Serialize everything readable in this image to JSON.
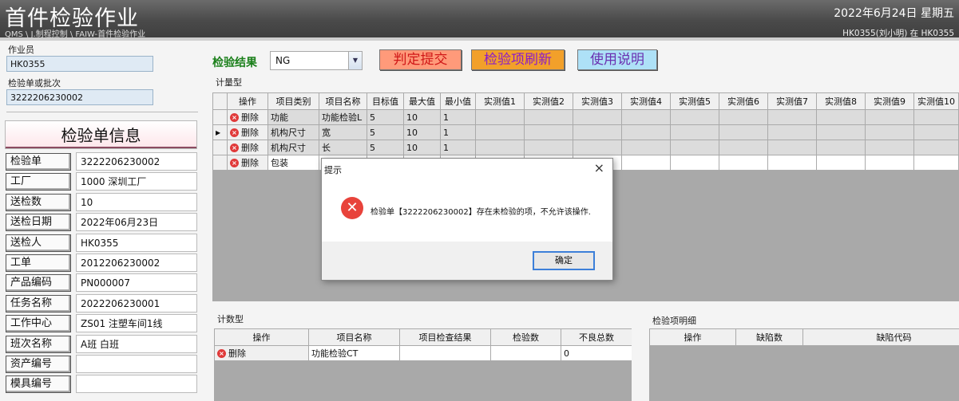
{
  "header": {
    "title": "首件检验作业",
    "breadcrumb": "QMS \\ J.制程控制 \\ FAIW-首件检验作业",
    "date": "2022年6月24日 星期五",
    "user": "HK0355(刘小明) 在 HK0355"
  },
  "left": {
    "operator_label": "作业员",
    "operator_value": "HK0355",
    "batch_label": "检验单或批次",
    "batch_value": "3222206230002",
    "info_title": "检验单信息",
    "rows": [
      {
        "k": "检验单",
        "v": "3222206230002"
      },
      {
        "k": "工厂",
        "v": "1000 深圳工厂"
      },
      {
        "k": "送检数",
        "v": "10"
      },
      {
        "k": "送检日期",
        "v": "2022年06月23日"
      },
      {
        "k": "送检人",
        "v": "HK0355"
      },
      {
        "k": "工单",
        "v": "2012206230002"
      },
      {
        "k": "产品编码",
        "v": "PN000007"
      },
      {
        "k": "任务名称",
        "v": "2022206230001"
      },
      {
        "k": "工作中心",
        "v": "ZS01 注塑车间1线"
      },
      {
        "k": "班次名称",
        "v": "A班 白班"
      },
      {
        "k": "资产编号",
        "v": ""
      },
      {
        "k": "模具编号",
        "v": ""
      }
    ]
  },
  "toolbar": {
    "result_label": "检验结果",
    "result_value": "NG",
    "submit_label": "判定提交",
    "refresh_label": "检验项刷新",
    "help_label": "使用说明"
  },
  "measure": {
    "section_label": "计量型",
    "columns": [
      "操作",
      "项目类别",
      "项目名称",
      "目标值",
      "最大值",
      "最小值",
      "实测值1",
      "实测值2",
      "实测值3",
      "实测值4",
      "实测值5",
      "实测值6",
      "实测值7",
      "实测值8",
      "实测值9",
      "实测值10"
    ],
    "delete_label": "删除",
    "rows": [
      {
        "cat": "功能",
        "name": "功能检验L",
        "target": "5",
        "max": "10",
        "min": "1"
      },
      {
        "cat": "机构尺寸",
        "name": "宽",
        "target": "5",
        "max": "10",
        "min": "1"
      },
      {
        "cat": "机构尺寸",
        "name": "长",
        "target": "5",
        "max": "10",
        "min": "1"
      },
      {
        "cat": "包装",
        "name": "",
        "target": "",
        "max": "",
        "min": ""
      }
    ]
  },
  "count": {
    "section_label": "计数型",
    "columns": [
      "操作",
      "项目名称",
      "项目检查结果",
      "检验数",
      "不良总数"
    ],
    "delete_label": "删除",
    "rows": [
      {
        "name": "功能检验CT",
        "result": "",
        "qty": "",
        "defects": "0"
      }
    ]
  },
  "detail": {
    "section_label": "检验项明细",
    "columns": [
      "操作",
      "缺陷数",
      "缺陷代码"
    ]
  },
  "dialog": {
    "title": "提示",
    "close": "×",
    "message": "检验单【3222206230002】存在未检验的项，不允许该操作.",
    "ok_label": "确定"
  }
}
